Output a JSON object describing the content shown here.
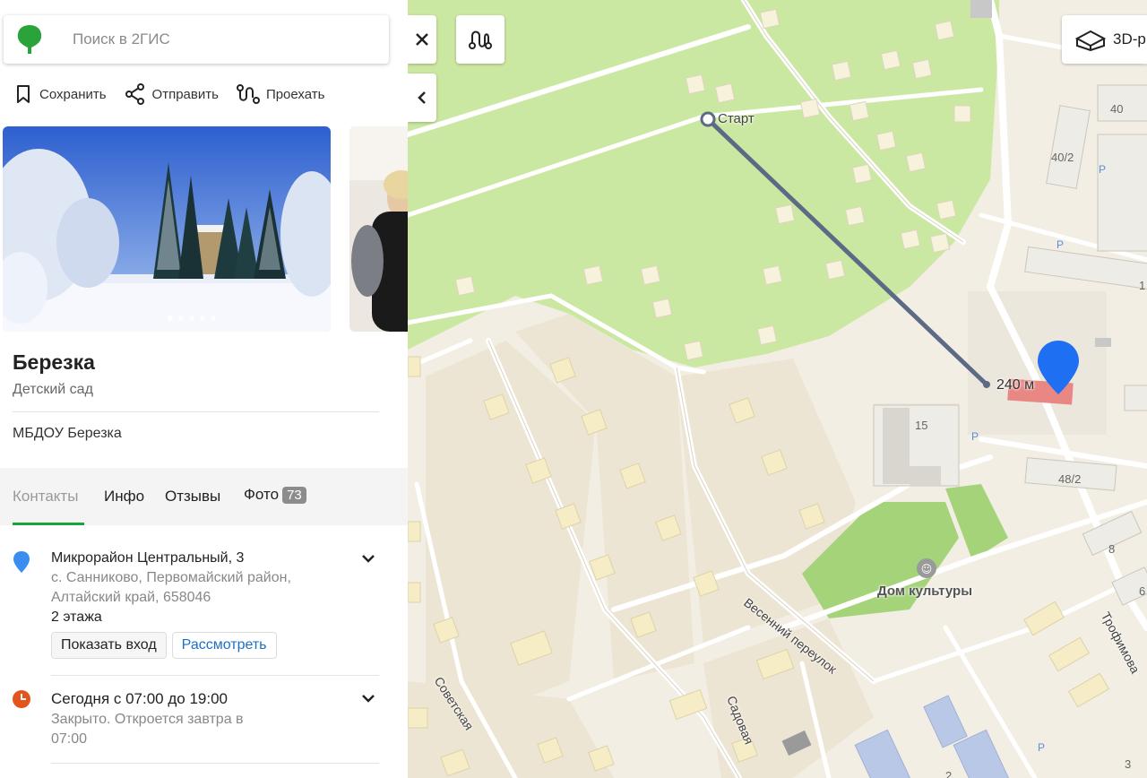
{
  "search": {
    "placeholder": "Поиск в 2ГИС"
  },
  "actions": [
    {
      "label": "Сохранить",
      "icon": "bookmark-icon"
    },
    {
      "label": "Отправить",
      "icon": "share-icon"
    },
    {
      "label": "Проехать",
      "icon": "route-icon"
    }
  ],
  "gallery": {
    "dots": 5,
    "active_dot": 1
  },
  "place": {
    "title": "Березка",
    "category": "Детский сад",
    "org_name": "МБДОУ Березка"
  },
  "tabs": [
    {
      "label": "Контакты",
      "active": true
    },
    {
      "label": "Инфо",
      "active": false
    },
    {
      "label": "Отзывы",
      "active": false
    },
    {
      "label": "Фото",
      "active": false,
      "count": "73"
    }
  ],
  "address": {
    "line1": "Микрорайон Центральный, 3",
    "line2": "с. Санниково, Первомайский район,",
    "line3": "Алтайский край, 658046",
    "floors": "2 этажа",
    "show_entrance": "Показать вход",
    "view": "Рассмотреть"
  },
  "hours": {
    "today": "Сегодня с 07:00 до 19:00",
    "status_line1": "Закрыто. Откроется завтра в",
    "status_line2": "07:00"
  },
  "map": {
    "start_label": "Старт",
    "distance_label": "240 м",
    "btn_3d": "3D-р",
    "street_labels": [
      "Весенний переулок",
      "Советская",
      "Садовая",
      "Трофимова"
    ],
    "poi_label": "Дом культуры",
    "house_numbers": [
      "15",
      "48/2",
      "40/2",
      "40",
      "8",
      "6",
      "1",
      "3",
      "2"
    ],
    "parking": "P"
  },
  "colors": {
    "accent_green": "#1aa33c",
    "link_blue": "#1e6fc4",
    "park_green": "#cbe8a2",
    "route": "#5d6a86",
    "pin_blue": "#1f6ff2"
  }
}
